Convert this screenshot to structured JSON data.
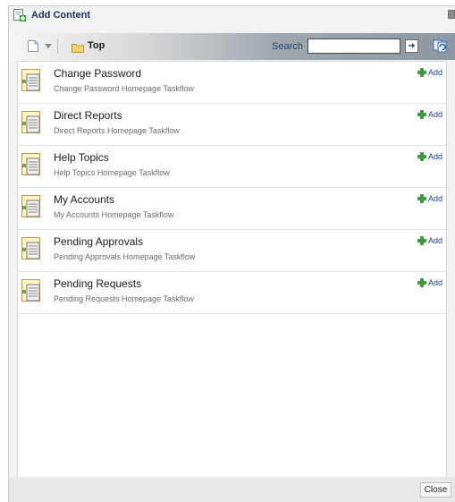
{
  "dialog": {
    "title": "Add Content"
  },
  "toolbar": {
    "breadcrumb_label": "Top",
    "search_label": "Search",
    "search_value": "",
    "go_glyph": "➜"
  },
  "items": [
    {
      "title": "Change Password",
      "description": "Change Password Homepage Taskflow",
      "add_label": "Add"
    },
    {
      "title": "Direct Reports",
      "description": "Direct Reports Homepage Taskflow",
      "add_label": "Add"
    },
    {
      "title": "Help Topics",
      "description": "Help Topics Homepage Taskflow",
      "add_label": "Add"
    },
    {
      "title": "My Accounts",
      "description": "My Accounts Homepage Taskflow",
      "add_label": "Add"
    },
    {
      "title": "Pending Approvals",
      "description": "Pending Approvals Homepage Taskflow",
      "add_label": "Add"
    },
    {
      "title": "Pending Requests",
      "description": "Pending Requests Homepage Taskflow",
      "add_label": "Add"
    }
  ],
  "footer": {
    "close_label": "Close"
  },
  "colors": {
    "accent": "#1f3f8a",
    "add_green": "#3c9a3c"
  },
  "icons": {
    "title": "add-content-icon",
    "doc": "document-icon",
    "folder": "folder-icon",
    "go": "go-arrow-icon",
    "refresh": "refresh-icon",
    "item": "taskflow-icon",
    "add": "plus-icon"
  }
}
